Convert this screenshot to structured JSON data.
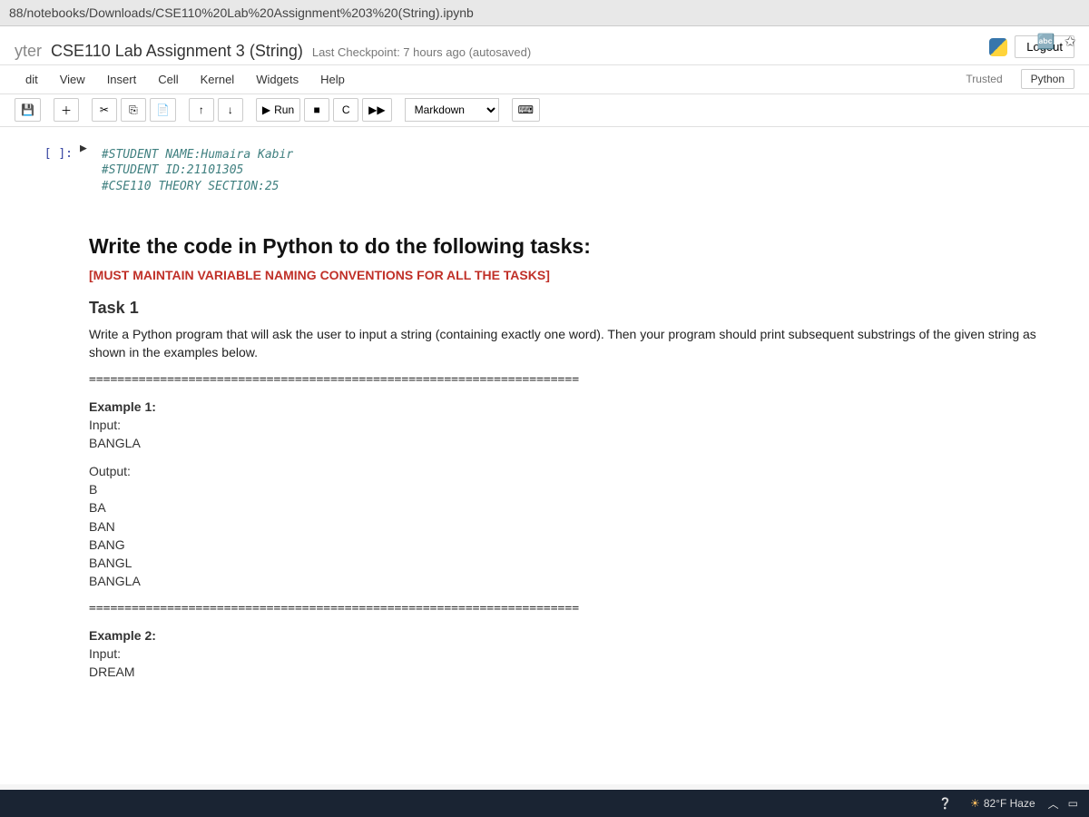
{
  "url": "88/notebooks/Downloads/CSE110%20Lab%20Assignment%203%20(String).ipynb",
  "header": {
    "logo_text": "yter",
    "title": "CSE110 Lab Assignment 3 (String)",
    "checkpoint": "Last Checkpoint: 7 hours ago  (autosaved)",
    "logout": "Logout"
  },
  "menus": {
    "items": [
      "dit",
      "View",
      "Insert",
      "Cell",
      "Kernel",
      "Widgets",
      "Help"
    ],
    "trusted": "Trusted",
    "kernel": "Python"
  },
  "toolbar": {
    "save_icon": "💾",
    "add_icon": "＋",
    "cut_icon": "✂",
    "copy_icon": "⎘",
    "paste_icon": "📄",
    "up_icon": "↑",
    "down_icon": "↓",
    "run_icon": "▶",
    "run_label": "Run",
    "stop_icon": "■",
    "restart_icon": "C",
    "restart_run_icon": "▶▶",
    "cell_type": "Markdown",
    "cmd_icon": "⌨"
  },
  "cells": {
    "code": {
      "prompt": "[ ]:",
      "run_marker": "▶",
      "lines": [
        "#STUDENT NAME:Humaira Kabir",
        "#STUDENT ID:21101305",
        "#CSE110 THEORY SECTION:25"
      ]
    },
    "md": {
      "heading": "Write the code in Python to do the following tasks:",
      "warn": "[MUST MAINTAIN VARIABLE NAMING CONVENTIONS FOR ALL THE TASKS]",
      "task_heading": "Task 1",
      "desc": "Write a Python program that will ask the user to input a string (containing exactly one word). Then your program should print subsequent substrings of the given string as shown in the examples below.",
      "hr": "=====================================================================",
      "ex1_title": "Example 1:",
      "ex1_input_label": "Input:",
      "ex1_input": "BANGLA",
      "ex1_output_label": "Output:",
      "ex1_output_lines": [
        "B",
        "BA",
        "BAN",
        "BANG",
        "BANGL",
        "BANGLA"
      ],
      "ex2_title": "Example 2:",
      "ex2_input_label": "Input:",
      "ex2_input": "DREAM"
    }
  },
  "taskbar": {
    "weather": "82°F Haze"
  }
}
